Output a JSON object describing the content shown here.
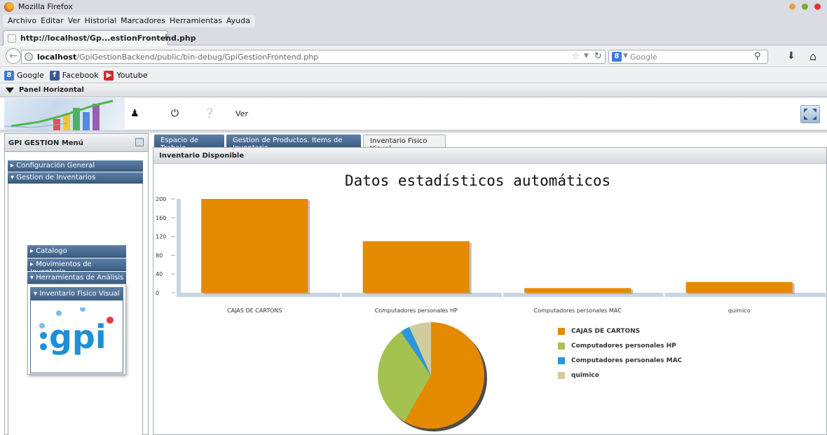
{
  "browser": {
    "window_title": "Mozilla Firefox",
    "menu": [
      "Archivo",
      "Editar",
      "Ver",
      "Historial",
      "Marcadores",
      "Herramientas",
      "Ayuda"
    ],
    "tab_title": "http://localhost/Gp...estionFrontend.php",
    "new_tab": "+",
    "url_host": "localhost",
    "url_path": "/GpiGestionBackend/public/bin-debug/GpiGestionFrontend.php",
    "search_placeholder": "Google",
    "bookmarks": [
      {
        "label": "Google",
        "icon": "google-icon",
        "color": "#3c7bd7"
      },
      {
        "label": "Facebook",
        "icon": "facebook-icon",
        "color": "#3b5998"
      },
      {
        "label": "Youtube",
        "icon": "youtube-icon",
        "color": "#d42a2a"
      }
    ]
  },
  "app": {
    "panel_label": "Panel Horizontal",
    "toolbar_text": "Ver",
    "menu_title": "GPI GESTION Menú",
    "accordion": [
      {
        "label": "▸ Configuración General"
      },
      {
        "label": "▾ Gestion de Inventarios"
      }
    ],
    "submenu": [
      {
        "label": "▸ Catalogo"
      },
      {
        "label": "▸ Movimientos de Inventario"
      },
      {
        "label": "▾ Herramientas de Análisis"
      }
    ],
    "inner_item": "▾ Inventario Fisico Visual",
    "logo_text": "gpi",
    "tabs": [
      {
        "label": "Espacio de Trabajo",
        "active": false
      },
      {
        "label": "Gestion de Productos. Items de Inventario",
        "active": false
      },
      {
        "label": "Inventario Fisico Visual",
        "active": true
      }
    ],
    "content_header": "Inventario Disponible"
  },
  "chart_data": [
    {
      "type": "bar",
      "title": "Datos estadísticos automáticos",
      "categories": [
        "CAJAS DE CARTONS",
        "Computadores personales HP",
        "Computadores personales MAC",
        "quimico"
      ],
      "values": [
        200,
        110,
        10,
        23
      ],
      "ylim": [
        0,
        200
      ],
      "yticks": [
        0,
        40,
        80,
        120,
        160,
        200
      ],
      "color": "#e58a00"
    },
    {
      "type": "pie",
      "categories": [
        "CAJAS DE CARTONS",
        "Computadores personales HP",
        "Computadores personales MAC",
        "quimico"
      ],
      "values": [
        200,
        110,
        10,
        23
      ],
      "colors": [
        "#e58a00",
        "#a4c24f",
        "#2b95dd",
        "#d1cca0"
      ]
    }
  ]
}
